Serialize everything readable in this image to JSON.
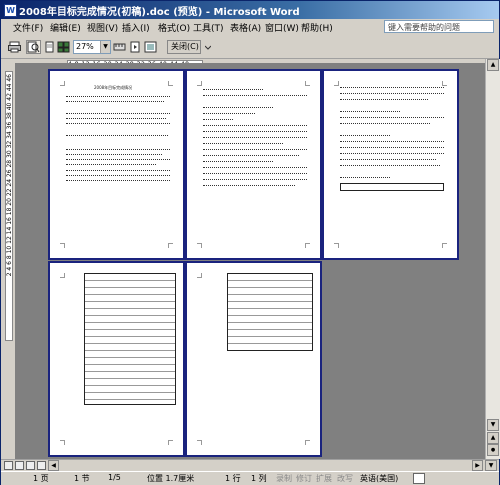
{
  "window": {
    "title": "2008年目标完成情况(初稿).doc (预览) - Microsoft Word"
  },
  "menu": {
    "items": [
      "文件(F)",
      "编辑(E)",
      "视图(V)",
      "插入(I)",
      "格式(O)",
      "工具(T)",
      "表格(A)",
      "窗口(W)",
      "帮助(H)"
    ]
  },
  "help_box": {
    "placeholder": "键入需要帮助的问题"
  },
  "toolbar": {
    "zoom": "27%",
    "close_label": "关闭(C)"
  },
  "ruler": {
    "ticks": "4   8  12 16 20 24 28 32 36 40 44 48"
  },
  "vruler": {
    "ticks": "2 4 6 8 10 12 14 16 18 20 22 24 26 28 30 32 34 36 38 40 42 44 46"
  },
  "pages": {
    "page1_title": "2008年目标完成情况"
  },
  "statusbar": {
    "page": "1 页",
    "section": "1 节",
    "page_of": "1/5",
    "position": "位置 1.7厘米",
    "line": "1 行",
    "column": "1 列",
    "rec": "录制",
    "trk": "修订",
    "ext": "扩展",
    "ovr": "改写",
    "language": "英语(美国)"
  }
}
